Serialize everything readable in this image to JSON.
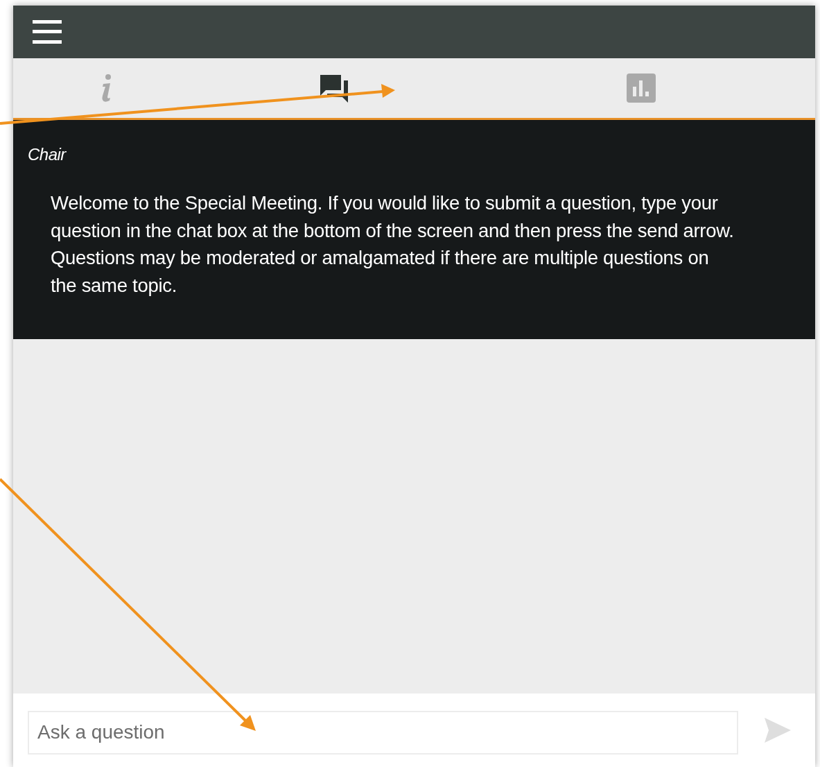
{
  "tabs": [
    {
      "kind": "info",
      "selected": false
    },
    {
      "kind": "chat",
      "selected": true
    },
    {
      "kind": "chart",
      "selected": false
    }
  ],
  "messages": [
    {
      "sender": "Chair",
      "text": "Welcome to the Special Meeting. If you would like to submit a question, type your question in the chat box at the bottom of the screen and then press the send arrow.  Questions may be moderated or amalgamated if there are multiple questions on the same topic."
    }
  ],
  "question_box": {
    "placeholder": "Ask a question"
  }
}
